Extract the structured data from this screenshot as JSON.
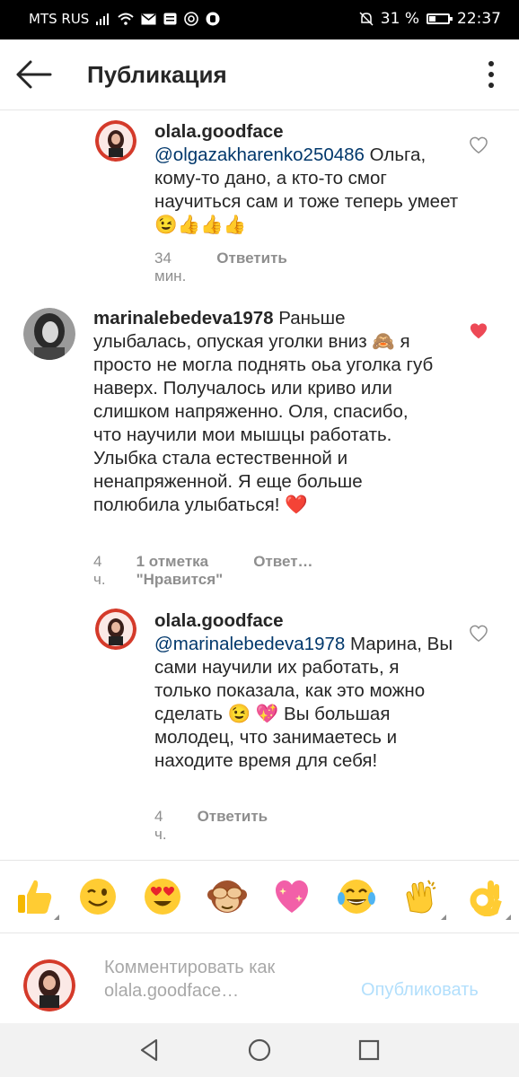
{
  "status_bar": {
    "carrier": "MTS RUS",
    "battery": "31 %",
    "time": "22:37"
  },
  "header": {
    "title": "Публикация"
  },
  "comments": [
    {
      "user": "olala.goodface",
      "mention": "@olgazakharenko250486",
      "text": " Ольга, кому-то дано, а кто-то смог научиться сам и тоже теперь умеет😉👍👍👍",
      "time": "34 мин.",
      "reply_label": "Ответить",
      "liked": false
    },
    {
      "user": "marinalebedeva1978",
      "text": " Раньше улыбалась, опуская уголки вниз 🙈 я просто не могла поднять оьа уголка губ наверх. Получалось или криво или слишком напряженно. Оля, спасибо, что научили мои мышцы работать. Улыбка стала естественной и ненапряженной. Я еще больше полюбила улыбаться! ❤️",
      "time": "4 ч.",
      "likes_label": "1 отметка \"Нравится\"",
      "reply_label": "Ответ…",
      "liked": true
    },
    {
      "user": "olala.goodface",
      "mention": "@marinalebedeva1978",
      "text": " Марина, Вы сами научили их работать, я только показала, как это можно сделать 😉 💖 Вы большая молодец, что занимаетесь и находите время для себя!",
      "time": "4 ч.",
      "reply_label": "Ответить",
      "liked": false
    }
  ],
  "emoji_bar": [
    "thumbs-up",
    "wink",
    "heart-eyes",
    "see-no-evil-monkey",
    "sparkling-heart",
    "tears-of-joy",
    "clapping-hands",
    "ok-hand"
  ],
  "composer": {
    "placeholder": "Комментировать как olala.goodface…",
    "publish_label": "Опубликовать"
  },
  "colors": {
    "heart_liked": "#ed4956",
    "mention": "#00376b",
    "publish": "#b2dffc"
  }
}
